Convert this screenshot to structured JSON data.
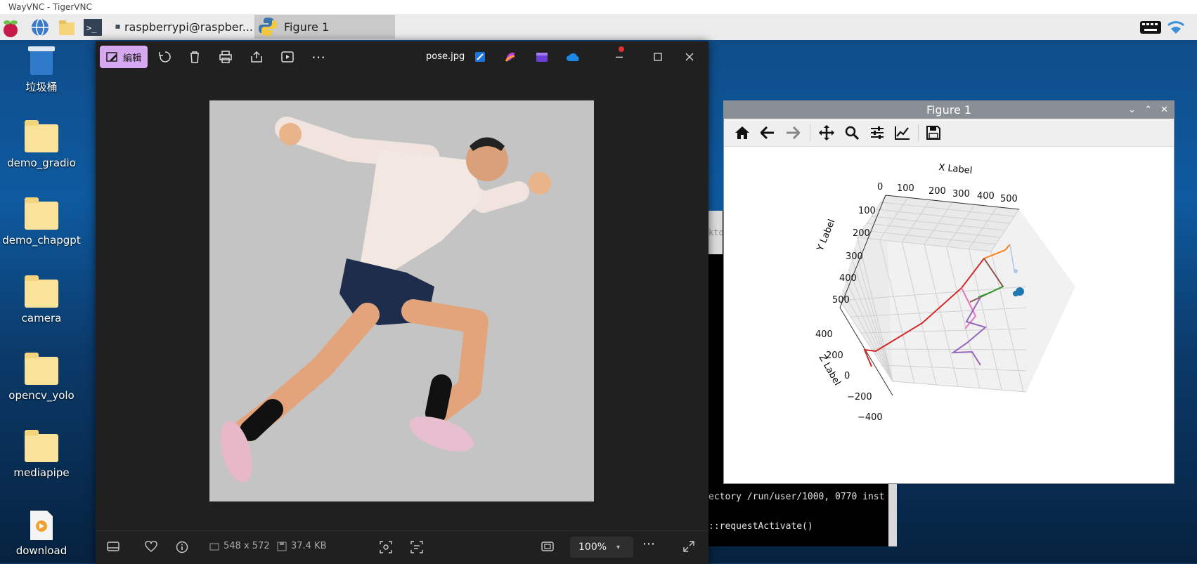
{
  "vnc": {
    "title": "WayVNC - TigerVNC"
  },
  "taskbar": {
    "tasks": [
      {
        "label": "raspberrypi@raspber..."
      },
      {
        "label": "Figure 1"
      }
    ]
  },
  "desktop": {
    "icons": [
      {
        "label": "垃圾桶",
        "icon": "trash-icon"
      },
      {
        "label": "demo_gradio",
        "icon": "folder-icon"
      },
      {
        "label": "demo_chapgpt",
        "icon": "folder-icon"
      },
      {
        "label": "camera",
        "icon": "folder-icon"
      },
      {
        "label": "opencv_yolo",
        "icon": "folder-icon"
      },
      {
        "label": "mediapipe",
        "icon": "folder-icon"
      },
      {
        "label": "download",
        "icon": "video-file-icon"
      }
    ]
  },
  "photos": {
    "edit_label": "編輯",
    "filename": "pose.jpg",
    "dimensions": "548 x 572",
    "filesize": "37.4 KB",
    "zoom": "100%"
  },
  "terminal": {
    "partial_label": "ktop",
    "lines": [
      "ectory /run/user/1000, 0770 inst",
      "::requestActivate()"
    ]
  },
  "figure": {
    "title": "Figure 1",
    "chart_data": {
      "type": "line3d",
      "title": "",
      "xlabel": "X Label",
      "ylabel": "Y Label",
      "zlabel": "Z Label",
      "x_ticks": [
        "0",
        "100",
        "200",
        "300",
        "400",
        "500"
      ],
      "y_ticks": [
        "100",
        "200",
        "300",
        "400",
        "500"
      ],
      "z_ticks": [
        "400",
        "200",
        "0",
        "−200",
        "−400"
      ],
      "colors": [
        "#d62728",
        "#ff7f0e",
        "#2ca02c",
        "#9467bd",
        "#e377c2",
        "#8c564b",
        "#1f77b4"
      ],
      "grid": true
    }
  }
}
